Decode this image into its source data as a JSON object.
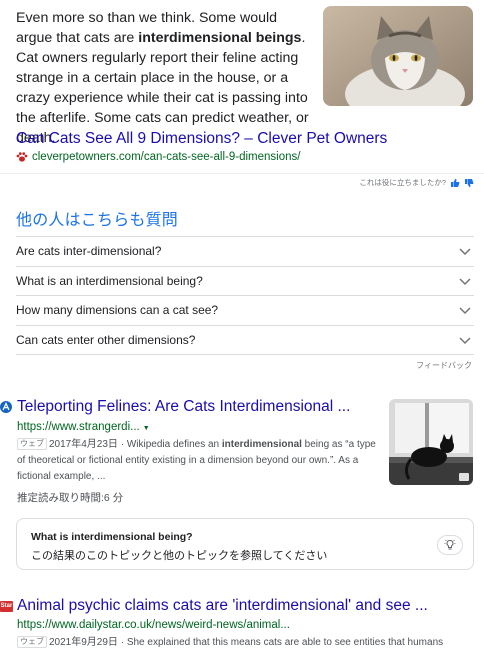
{
  "featured_snippet": {
    "text_part1": "Even more so than we think. Some would argue that cats are ",
    "text_bold": "interdimensional beings",
    "text_part2": ". Cat owners regularly report their feline acting strange in a certain place in the house, or a crazy experience while their cat is passing into the afterlife. Some cats can predict weather, or death.",
    "title": "Can Cats See All 9 Dimensions? – Clever Pet Owners",
    "cite": "cleverpetowners.com/can-cats-see-all-9-dimensions/",
    "image_icon": "cat-photo",
    "feedback_question": "これは役に立ちましたか?"
  },
  "people_also_ask": {
    "heading": "他の人はこちらも質問",
    "questions": [
      "Are cats inter-dimensional?",
      "What is an interdimensional being?",
      "How many dimensions can a cat see?",
      "Can cats enter other dimensions?"
    ],
    "feedback": "フィードバック"
  },
  "results": [
    {
      "title": "Teleporting Felines: Are Cats Interdimensional ...",
      "url": "https://www.strangerdi...",
      "badge": "ウェブ",
      "date": "2017年4月23日",
      "snippet_pre": " · Wikipedia defines an ",
      "snippet_bold": "interdimensional",
      "snippet_post": " being as “a type of theoretical or fictional entity existing in a dimension beyond our own.”. As a fictional example, ...",
      "read_time": "推定読み取り時間:6 分",
      "thumbnail_icon": "cat-window-photo"
    },
    {
      "title": "Animal psychic claims cats are 'interdimensional' and see ...",
      "url": "https://www.dailystar.co.uk/news/weird-news/animal...",
      "badge": "ウェブ",
      "date": "2021年9月29日",
      "snippet": " · She explained that this means cats are able to see entities that humans",
      "favicon_text": "Star"
    }
  ],
  "topic_box": {
    "title": "What is interdimensional being?",
    "subtitle": "この結果のこのトピックと他のトピックを参照してください",
    "icon": "lightbulb-icon"
  },
  "colors": {
    "link": "#1a0dab",
    "url_green": "#006621",
    "heading_blue": "#1a73e8",
    "thumb_blue": "#1a73e8"
  }
}
